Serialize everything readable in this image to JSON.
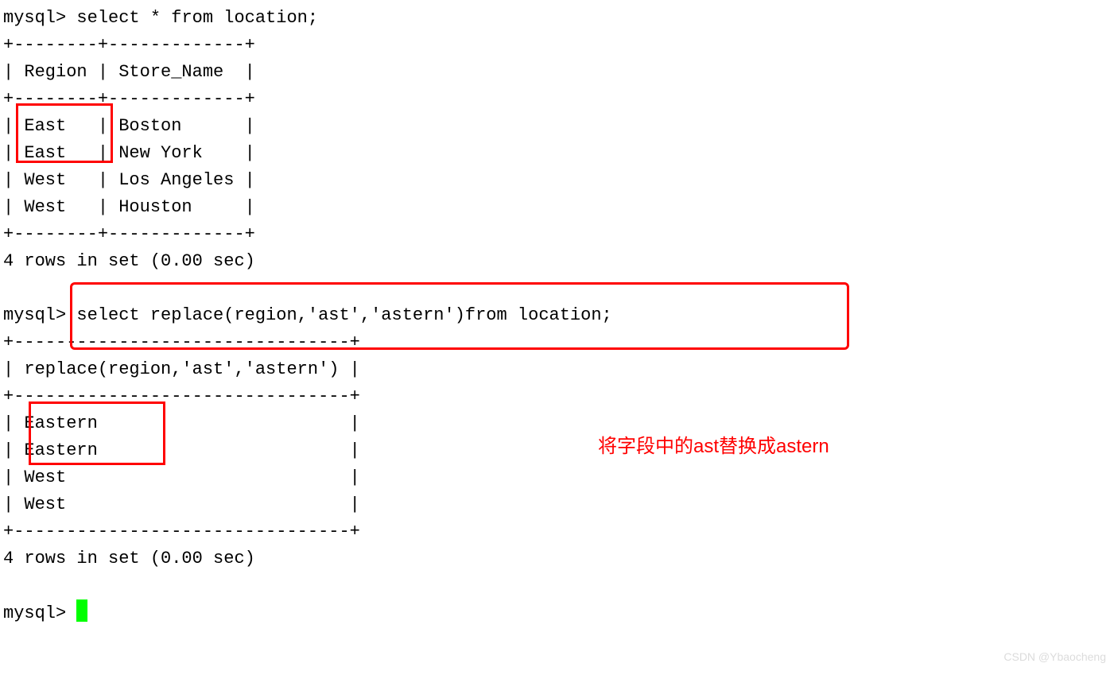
{
  "prompt": "mysql>",
  "query1": {
    "command": "select * from location;",
    "border_top": "+--------+-------------+",
    "header": "| Region | Store_Name  |",
    "border_mid": "+--------+-------------+",
    "rows": [
      {
        "line": "| East   | Boston      |",
        "region": "East",
        "store": "Boston"
      },
      {
        "line": "| East   | New York    |",
        "region": "East",
        "store": "New York"
      },
      {
        "line": "| West   | Los Angeles |",
        "region": "West",
        "store": "Los Angeles"
      },
      {
        "line": "| West   | Houston     |",
        "region": "West",
        "store": "Houston"
      }
    ],
    "border_bot": "+--------+-------------+",
    "summary": "4 rows in set (0.00 sec)"
  },
  "query2": {
    "command": "select replace(region,'ast','astern')from location;",
    "border_top": "+--------------------------------+",
    "header": "| replace(region,'ast','astern') |",
    "border_mid": "+--------------------------------+",
    "rows": [
      {
        "line": "| Eastern                        |",
        "value": "Eastern"
      },
      {
        "line": "| Eastern                        |",
        "value": "Eastern"
      },
      {
        "line": "| West                           |",
        "value": "West"
      },
      {
        "line": "| West                           |",
        "value": "West"
      }
    ],
    "border_bot": "+--------------------------------+",
    "summary": "4 rows in set (0.00 sec)"
  },
  "annotation_text": "将字段中的ast替换成astern",
  "watermark": "CSDN @Ybaocheng"
}
